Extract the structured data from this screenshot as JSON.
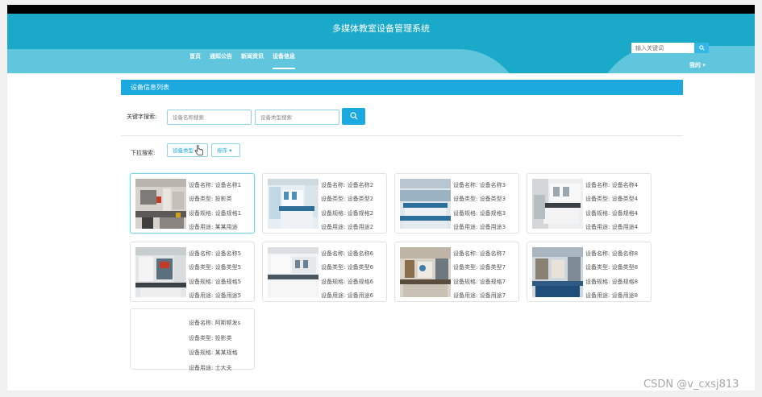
{
  "header": {
    "title": "多媒体教室设备管理系统",
    "search_placeholder": "输入关键词",
    "user_menu": "我的 ▾"
  },
  "nav": [
    "首页",
    "通知公告",
    "新闻资讯",
    "设备信息"
  ],
  "panel": {
    "title": "设备信息列表"
  },
  "filters": {
    "keyword_label": "关键字搜索:",
    "name_placeholder": "设备名称搜索",
    "type_placeholder": "设备类型搜索",
    "dropdown_label": "下拉搜索:",
    "type_dropdown": "设备类型",
    "sort_dropdown": "排序 ▾"
  },
  "device_labels": {
    "name": "设备名称:",
    "type": "设备类型:",
    "spec": "设备规格:",
    "use": "设备用途:"
  },
  "devices": [
    {
      "name": "设备名称1",
      "type": "投影类",
      "spec": "设备规格1",
      "use": "某某用途",
      "thumb": "lab-dark"
    },
    {
      "name": "设备名称2",
      "type": "设备类型2",
      "spec": "设备规格2",
      "use": "设备用途2",
      "thumb": "lab-blue"
    },
    {
      "name": "设备名称3",
      "type": "设备类型3",
      "spec": "设备规格3",
      "use": "设备用途3",
      "thumb": "lab-wide"
    },
    {
      "name": "设备名称4",
      "type": "设备类型4",
      "spec": "设备规格4",
      "use": "设备用途4",
      "thumb": "lab-white"
    },
    {
      "name": "设备名称5",
      "type": "设备类型5",
      "spec": "设备规格5",
      "use": "设备用途5",
      "thumb": "lab-red"
    },
    {
      "name": "设备名称6",
      "type": "设备类型6",
      "spec": "设备规格6",
      "use": "设备用途6",
      "thumb": "lab-bright"
    },
    {
      "name": "设备名称7",
      "type": "设备类型7",
      "spec": "设备规格7",
      "use": "设备用途7",
      "thumb": "lab-bench"
    },
    {
      "name": "设备名称8",
      "type": "设备类型8",
      "spec": "设备规格8",
      "use": "设备用途8",
      "thumb": "lab-equip"
    },
    {
      "name": "阿斯顿发s",
      "type": "投影类",
      "spec": "某某规格",
      "use": "士大夫",
      "thumb": "partial"
    }
  ],
  "watermark": "CSDN @v_cxsj813",
  "colors": {
    "header": "#1ba9c9",
    "header_wave": "#5fc6de",
    "accent": "#1ba9e0"
  }
}
